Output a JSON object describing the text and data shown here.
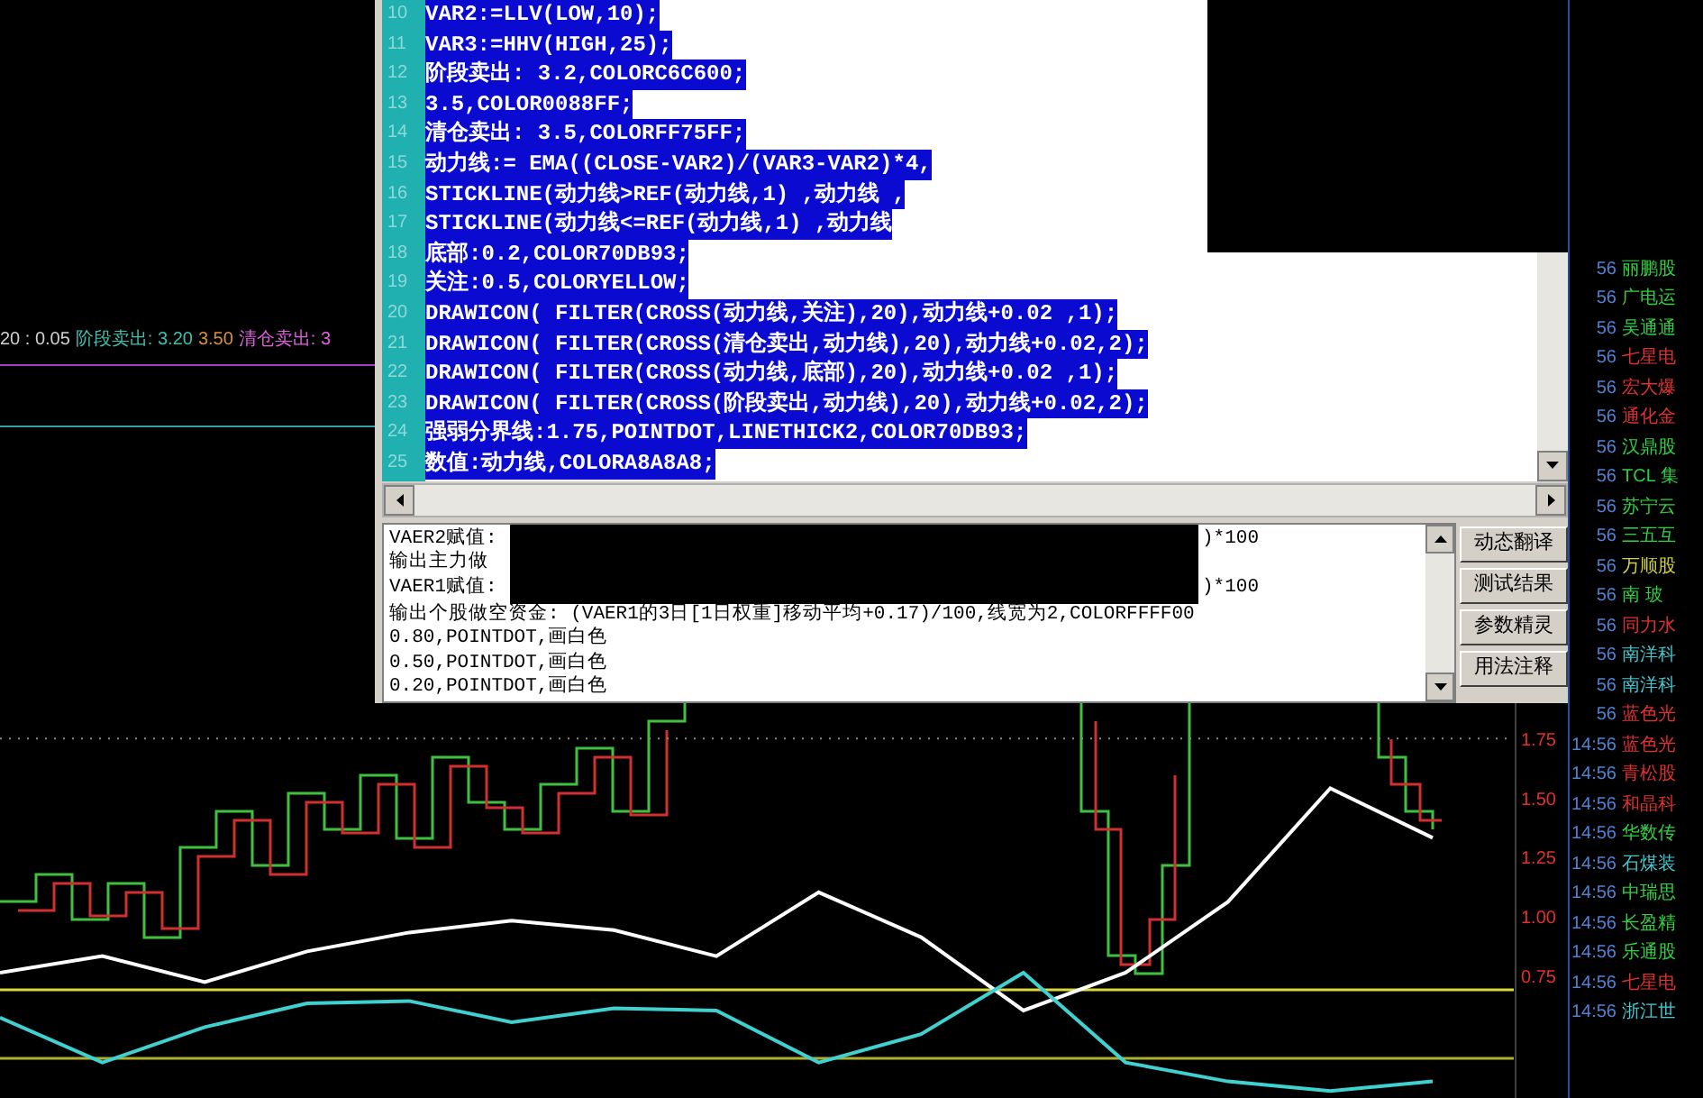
{
  "indicator_legend": [
    {
      "text": "20 : 0.05",
      "color": "#d0d0d0"
    },
    {
      "text": "阶段卖出: 3.20",
      "color": "#3cc0b0"
    },
    {
      "text": "3.50",
      "color": "#d8903c"
    },
    {
      "text": "清仓卖出: 3",
      "color": "#e060e0"
    }
  ],
  "editor": {
    "lines": [
      {
        "number": "10",
        "code": "VAR2:=LLV(LOW,10);",
        "selected": true
      },
      {
        "number": "11",
        "code": "VAR3:=HHV(HIGH,25);",
        "selected": true
      },
      {
        "number": "12",
        "code": "阶段卖出: 3.2,COLORC6C600;",
        "selected": true
      },
      {
        "number": "13",
        "code": "3.5,COLOR0088FF;",
        "selected": true
      },
      {
        "number": "14",
        "code": "清仓卖出: 3.5,COLORFF75FF;",
        "selected": true
      },
      {
        "number": "15",
        "code": "动力线:= EMA((CLOSE-VAR2)/(VAR3-VAR2)*4,",
        "selected": true
      },
      {
        "number": "16",
        "code": "STICKLINE(动力线>REF(动力线,1) ,动力线 ,",
        "selected": true
      },
      {
        "number": "17",
        "code": "STICKLINE(动力线<=REF(动力线,1) ,动力线",
        "selected": true
      },
      {
        "number": "18",
        "code": "底部:0.2,COLOR70DB93;",
        "selected": true
      },
      {
        "number": "19",
        "code": "关注:0.5,COLORYELLOW;",
        "selected": true
      },
      {
        "number": "20",
        "code": "DRAWICON( FILTER(CROSS(动力线,关注),20),动力线+0.02 ,1);",
        "selected": true
      },
      {
        "number": "21",
        "code": "DRAWICON( FILTER(CROSS(清仓卖出,动力线),20),动力线+0.02,2);",
        "selected": true
      },
      {
        "number": "22",
        "code": "DRAWICON( FILTER(CROSS(动力线,底部),20),动力线+0.02 ,1);",
        "selected": true
      },
      {
        "number": "23",
        "code": "DRAWICON( FILTER(CROSS(阶段卖出,动力线),20),动力线+0.02,2);",
        "selected": true
      },
      {
        "number": "24",
        "code": "强弱分界线:1.75,POINTDOT,LINETHICK2,COLOR70DB93;",
        "selected": true
      },
      {
        "number": "25",
        "code": "数值:动力线,COLORA8A8A8;",
        "selected": true
      }
    ],
    "output_lines": [
      {
        "kind": "redacted",
        "left": "VAER2赋值:",
        "right": ")*100"
      },
      {
        "kind": "redacted",
        "left": "输出主力做"
      },
      {
        "kind": "redacted",
        "left": "VAER1赋值:",
        "right": ")*100"
      },
      {
        "kind": "plain",
        "left": "输出个股做空资金: (VAER1的3日[1日权重]移动平均+0.17)/100,线宽为2,COLORFFFF00"
      },
      {
        "kind": "plain",
        "left": "0.80,POINTDOT,画白色"
      },
      {
        "kind": "plain",
        "left": "0.50,POINTDOT,画白色"
      },
      {
        "kind": "plain",
        "left": "0.20,POINTDOT,画白色"
      }
    ],
    "buttons": [
      "动态翻译",
      "测试结果",
      "参数精灵",
      "用法注释"
    ]
  },
  "chart": {
    "chart_data": {
      "type": "line",
      "ylim": [
        0.23,
        1.9
      ],
      "yticks": [
        {
          "value": 1.75,
          "label": "1.75"
        },
        {
          "value": 1.5,
          "label": "1.50"
        },
        {
          "value": 1.25,
          "label": "1.25"
        },
        {
          "value": 1.0,
          "label": "1.00"
        },
        {
          "value": 0.75,
          "label": "0.75"
        }
      ],
      "series": [
        {
          "color": "#ffffff",
          "values": [
            0.76,
            0.83,
            0.72,
            0.85,
            0.93,
            0.98,
            0.94,
            0.83,
            1.1,
            0.91,
            0.6,
            0.76,
            1.06,
            1.54,
            1.33
          ]
        },
        {
          "color": "#40d0d0",
          "values": [
            0.57,
            0.38,
            0.53,
            0.63,
            0.64,
            0.55,
            0.61,
            0.6,
            0.38,
            0.5,
            0.76,
            0.38,
            0.3,
            0.26,
            0.3
          ]
        }
      ]
    }
  },
  "stock_list": [
    {
      "time": "56",
      "name": "丽鹏股",
      "color": "#30d040"
    },
    {
      "time": "56",
      "name": "广电运",
      "color": "#30d040"
    },
    {
      "time": "56",
      "name": "吴通通",
      "color": "#30d040"
    },
    {
      "time": "56",
      "name": "七星电",
      "color": "#e03030"
    },
    {
      "time": "56",
      "name": "宏大爆",
      "color": "#e03030"
    },
    {
      "time": "56",
      "name": "通化金",
      "color": "#e03030"
    },
    {
      "time": "56",
      "name": "汉鼎股",
      "color": "#30d040"
    },
    {
      "time": "56",
      "name": "TCL 集",
      "color": "#30d040"
    },
    {
      "time": "56",
      "name": "苏宁云",
      "color": "#30d040"
    },
    {
      "time": "56",
      "name": "三五互",
      "color": "#30d040"
    },
    {
      "time": "56",
      "name": "万顺股",
      "color": "#d0d040"
    },
    {
      "time": "56",
      "name": "南 玻",
      "color": "#30d040"
    },
    {
      "time": "56",
      "name": "同力水",
      "color": "#e03030"
    },
    {
      "time": "56",
      "name": "南洋科",
      "color": "#40c8d0"
    },
    {
      "time": "56",
      "name": "南洋科",
      "color": "#40c8d0"
    },
    {
      "time": "56",
      "name": "蓝色光",
      "color": "#e03030"
    },
    {
      "time": "14:56",
      "name": "蓝色光",
      "color": "#e03030"
    },
    {
      "time": "14:56",
      "name": "青松股",
      "color": "#e03030"
    },
    {
      "time": "14:56",
      "name": "和晶科",
      "color": "#e03030"
    },
    {
      "time": "14:56",
      "name": "华数传",
      "color": "#30d040"
    },
    {
      "time": "14:56",
      "name": "石煤装",
      "color": "#40c8d0"
    },
    {
      "time": "14:56",
      "name": "中瑞思",
      "color": "#30d040"
    },
    {
      "time": "14:56",
      "name": "长盈精",
      "color": "#30d040"
    },
    {
      "time": "14:56",
      "name": "乐通股",
      "color": "#30d040"
    },
    {
      "time": "14:56",
      "name": "七星电",
      "color": "#e03030"
    },
    {
      "time": "14:56",
      "name": "浙江世",
      "color": "#40c8d0"
    }
  ]
}
